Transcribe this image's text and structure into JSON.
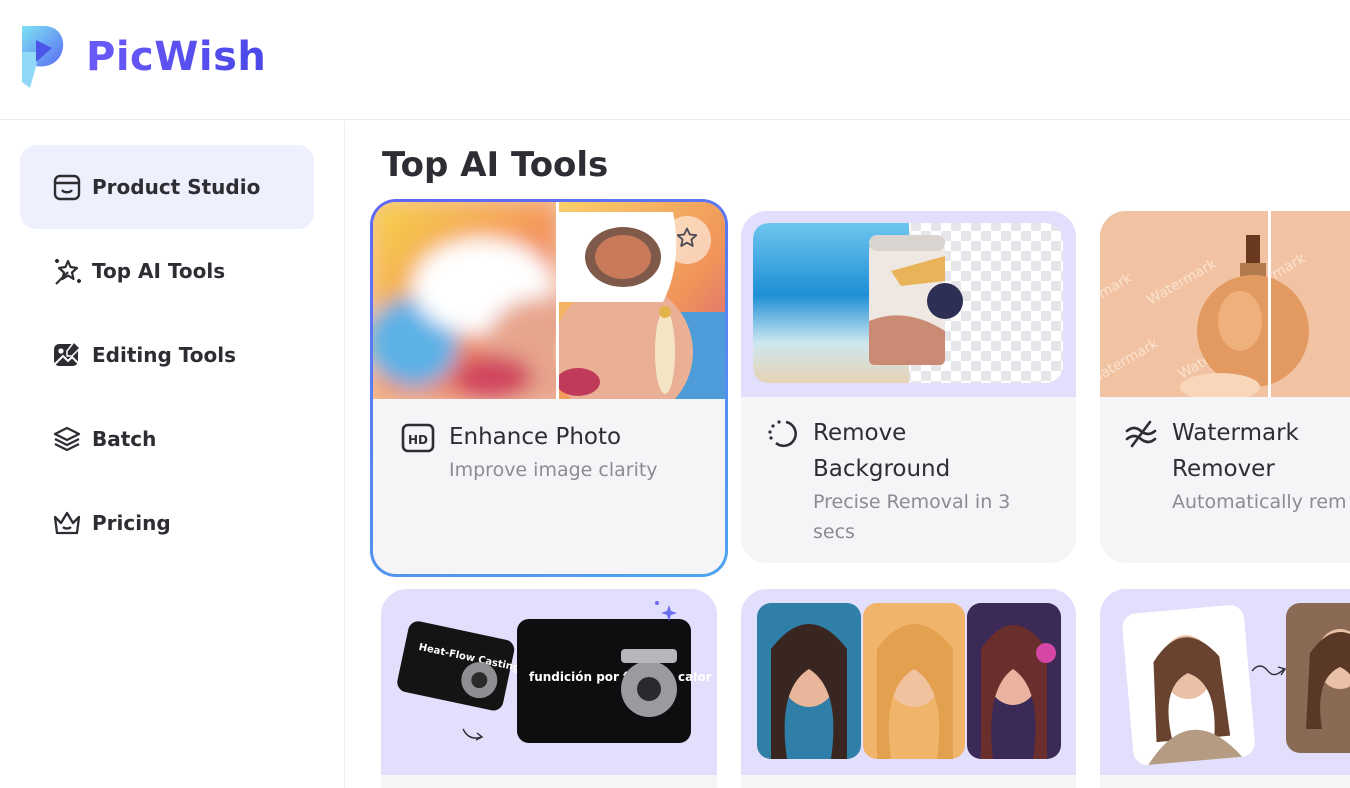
{
  "brand": {
    "name": "PicWish"
  },
  "sidebar": {
    "items": [
      {
        "label": "Product Studio",
        "icon": "product-box-icon",
        "active": true
      },
      {
        "label": "Top AI Tools",
        "icon": "magic-wand-icon",
        "active": false
      },
      {
        "label": "Editing Tools",
        "icon": "image-edit-icon",
        "active": false
      },
      {
        "label": "Batch",
        "icon": "layers-icon",
        "active": false
      },
      {
        "label": "Pricing",
        "icon": "crown-icon",
        "active": false
      }
    ]
  },
  "main": {
    "title": "Top AI Tools",
    "tools": [
      {
        "title": "Enhance Photo",
        "desc": "Improve image clarity",
        "icon": "hd-icon"
      },
      {
        "title": "Remove Background",
        "desc": "Precise Removal in 3 secs",
        "icon": "dotted-circle-icon"
      },
      {
        "title": "Watermark Remover",
        "desc": "Automatically rem text",
        "icon": "strikethrough-approx-icon"
      }
    ],
    "thumb_text": {
      "watermark": "Watermark",
      "product_a": "Heat-Flow Casting",
      "product_b": "fundición por flujo de calor"
    }
  },
  "colors": {
    "accent": "#5b5cf0",
    "active_bg": "#eef0fd",
    "card_bg": "#f5f5f7",
    "thumb_bg": "#e1dffb"
  }
}
